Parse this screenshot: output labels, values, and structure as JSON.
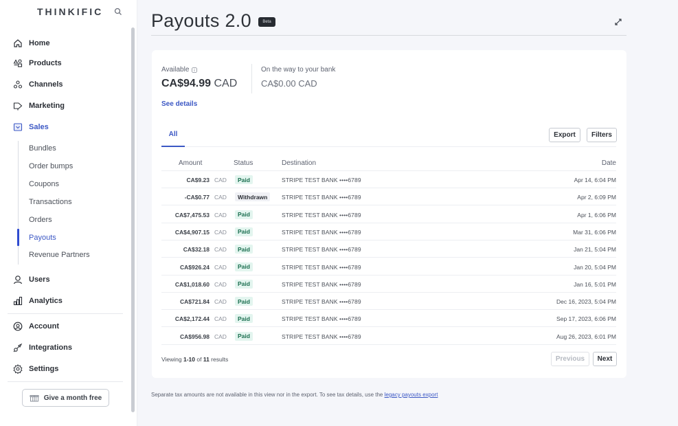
{
  "sidebar": {
    "brand": "THINKIFIC",
    "nav_primary": [
      {
        "label": "Home",
        "icon": "home-icon"
      },
      {
        "label": "Products",
        "icon": "products-icon"
      },
      {
        "label": "Channels",
        "icon": "channels-icon"
      },
      {
        "label": "Marketing",
        "icon": "megaphone-icon"
      },
      {
        "label": "Sales",
        "icon": "sales-icon",
        "active": true
      }
    ],
    "sales_subitems": [
      {
        "label": "Bundles"
      },
      {
        "label": "Order bumps"
      },
      {
        "label": "Coupons"
      },
      {
        "label": "Transactions"
      },
      {
        "label": "Orders"
      },
      {
        "label": "Payouts",
        "active": true
      },
      {
        "label": "Revenue Partners"
      }
    ],
    "nav_secondary": [
      {
        "label": "Users",
        "icon": "user-icon"
      },
      {
        "label": "Analytics",
        "icon": "analytics-icon"
      }
    ],
    "nav_tertiary": [
      {
        "label": "Account",
        "icon": "account-icon"
      },
      {
        "label": "Integrations",
        "icon": "integrations-icon"
      },
      {
        "label": "Settings",
        "icon": "gear-icon"
      }
    ],
    "gift_button": "Give a month free"
  },
  "header": {
    "title": "Payouts 2.0",
    "badge": "Beta"
  },
  "balances": {
    "available_label": "Available",
    "available_amount": "CA$94.99",
    "available_currency": "CAD",
    "on_the_way_label": "On the way to your bank",
    "on_the_way_amount": "CA$0.00 CAD",
    "see_details": "See details"
  },
  "tabs": [
    {
      "label": "All",
      "active": true
    }
  ],
  "toolbar": {
    "export": "Export",
    "filters": "Filters"
  },
  "table": {
    "columns": {
      "amount": "Amount",
      "status": "Status",
      "destination": "Destination",
      "date": "Date"
    },
    "rows": [
      {
        "amount": "CA$9.23",
        "currency": "CAD",
        "status": "Paid",
        "destination": "STRIPE TEST BANK ••••6789",
        "date": "Apr 14, 6:04 PM"
      },
      {
        "amount": "-CA$0.77",
        "currency": "CAD",
        "status": "Withdrawn",
        "destination": "STRIPE TEST BANK ••••6789",
        "date": "Apr 2, 6:09 PM"
      },
      {
        "amount": "CA$7,475.53",
        "currency": "CAD",
        "status": "Paid",
        "destination": "STRIPE TEST BANK ••••6789",
        "date": "Apr 1, 6:06 PM"
      },
      {
        "amount": "CA$4,907.15",
        "currency": "CAD",
        "status": "Paid",
        "destination": "STRIPE TEST BANK ••••6789",
        "date": "Mar 31, 6:06 PM"
      },
      {
        "amount": "CA$32.18",
        "currency": "CAD",
        "status": "Paid",
        "destination": "STRIPE TEST BANK ••••6789",
        "date": "Jan 21, 5:04 PM"
      },
      {
        "amount": "CA$926.24",
        "currency": "CAD",
        "status": "Paid",
        "destination": "STRIPE TEST BANK ••••6789",
        "date": "Jan 20, 5:04 PM"
      },
      {
        "amount": "CA$1,018.60",
        "currency": "CAD",
        "status": "Paid",
        "destination": "STRIPE TEST BANK ••••6789",
        "date": "Jan 16, 5:01 PM"
      },
      {
        "amount": "CA$721.84",
        "currency": "CAD",
        "status": "Paid",
        "destination": "STRIPE TEST BANK ••••6789",
        "date": "Dec 16, 2023, 5:04 PM"
      },
      {
        "amount": "CA$2,172.44",
        "currency": "CAD",
        "status": "Paid",
        "destination": "STRIPE TEST BANK ••••6789",
        "date": "Sep 17, 2023, 6:06 PM"
      },
      {
        "amount": "CA$956.98",
        "currency": "CAD",
        "status": "Paid",
        "destination": "STRIPE TEST BANK ••••6789",
        "date": "Aug 26, 2023, 6:01 PM"
      }
    ]
  },
  "pagination": {
    "viewing_prefix": "Viewing ",
    "range": "1-10",
    "of": " of ",
    "total": "11",
    "suffix": " results",
    "previous": "Previous",
    "next": "Next"
  },
  "footer": {
    "note": "Separate tax amounts are not available in this view nor in the export. To see tax details, use the ",
    "link": "legacy payouts export"
  },
  "colors": {
    "accent": "#3b57c4",
    "paid_bg": "#e3f5ef",
    "paid_text": "#1b6e4f",
    "page_bg": "#f5f6fa"
  }
}
